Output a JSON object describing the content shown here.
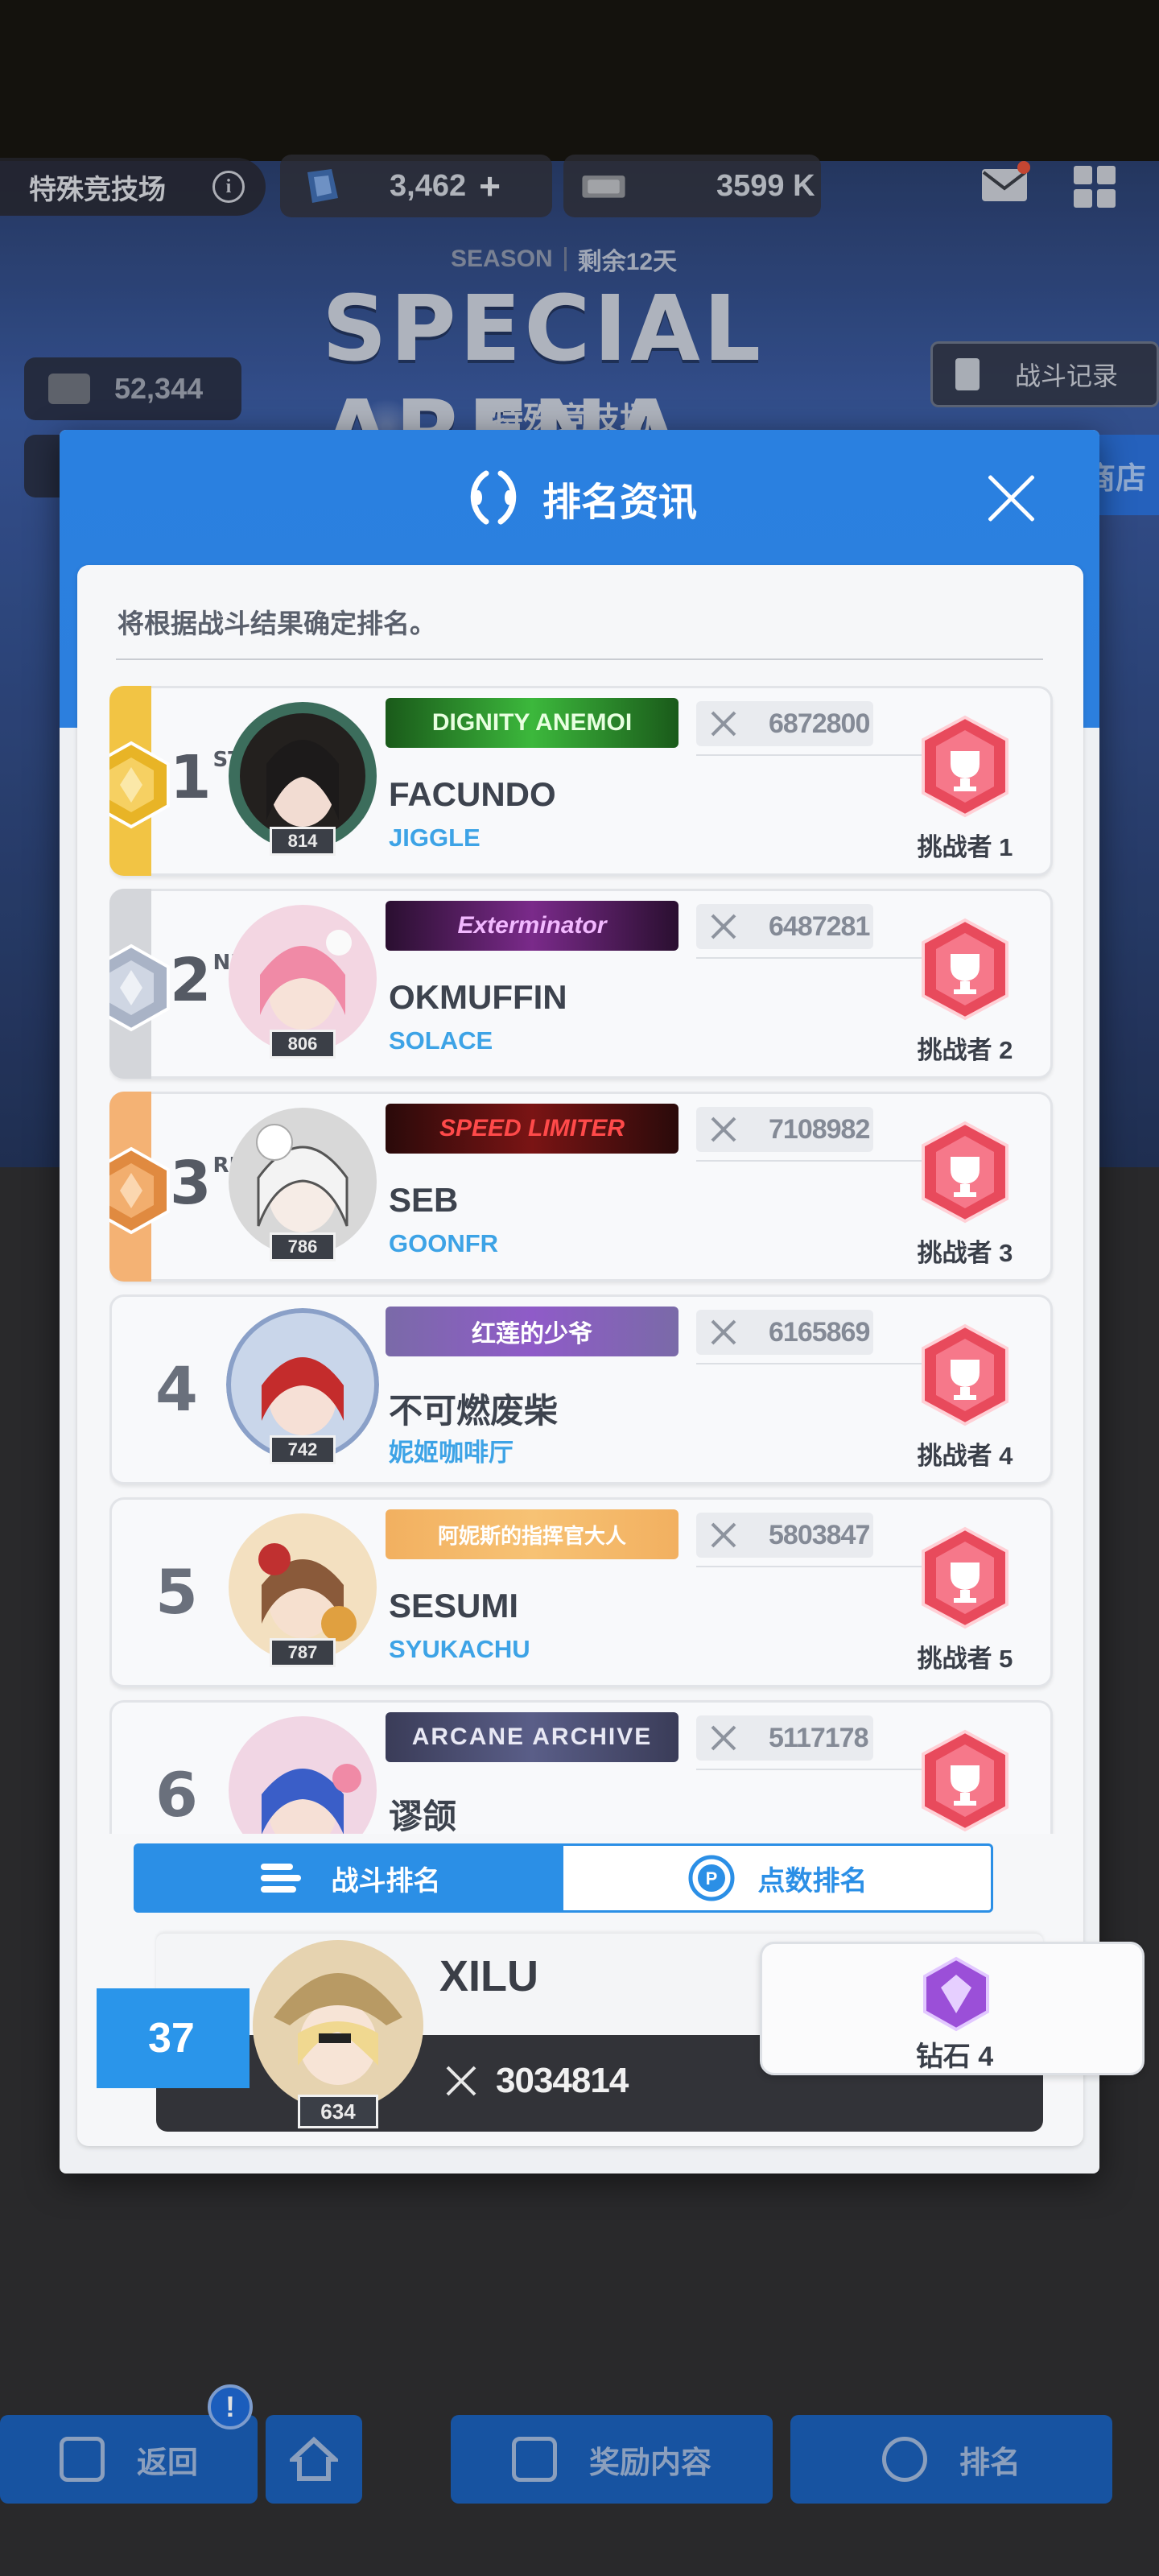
{
  "hud": {
    "mode_title": "特殊竞技场",
    "info_icon": "info-icon",
    "gems": "3,462",
    "gems_plus": "+",
    "credits": "3599 K",
    "ticket_count": "52,344"
  },
  "season": {
    "label": "SEASON",
    "remaining": "剩余12天",
    "title": "SPECIAL ARENA",
    "subtitle": "特殊竞技场"
  },
  "side_buttons": {
    "battle_record": "战斗记录",
    "shop": "商店"
  },
  "modal": {
    "title": "排名资讯",
    "notice": "将根据战斗结果确定排名。",
    "rows": [
      {
        "rank": "1",
        "suffix": "ST",
        "medal": "gold",
        "level": "814",
        "banner": "DIGNITY ANEMOI",
        "power": "6872800",
        "name": "FACUNDO",
        "guild": "JIGGLE",
        "challenge": "挑战者 1"
      },
      {
        "rank": "2",
        "suffix": "ND",
        "medal": "silver",
        "level": "806",
        "banner": "Exterminator",
        "power": "6487281",
        "name": "OKMUFFIN",
        "guild": "SOLACE",
        "challenge": "挑战者 2"
      },
      {
        "rank": "3",
        "suffix": "RD",
        "medal": "bronze",
        "level": "786",
        "banner": "SPEED LIMITER",
        "power": "7108982",
        "name": "SEB",
        "guild": "GOONFR",
        "challenge": "挑战者 3"
      },
      {
        "rank": "4",
        "suffix": "",
        "medal": "",
        "level": "742",
        "banner": "红莲的少爷",
        "power": "6165869",
        "name": "不可燃废柴",
        "guild": "妮姬咖啡厅",
        "challenge": "挑战者 4"
      },
      {
        "rank": "5",
        "suffix": "",
        "medal": "",
        "level": "787",
        "banner": "阿妮斯的指挥官大人",
        "power": "5803847",
        "name": "SESUMI",
        "guild": "SYUKACHU",
        "challenge": "挑战者 5"
      },
      {
        "rank": "6",
        "suffix": "",
        "medal": "",
        "level": "",
        "banner": "ARCANE ARCHIVE",
        "power": "5117178",
        "name": "谬颌",
        "guild": "",
        "challenge": ""
      }
    ],
    "tabs": {
      "battle": "战斗排名",
      "points": "点数排名"
    },
    "self": {
      "rank": "37",
      "level": "634",
      "name": "XILU",
      "power": "3034814",
      "tier": "钻石 4"
    }
  },
  "bottom_nav": {
    "back": "返回",
    "rewards": "奖励内容",
    "ranking": "排名",
    "alert": "!"
  },
  "colors": {
    "accent_blue": "#2b8fe6",
    "gold_stripe": "#f2c444",
    "silver_stripe": "#d4d6da",
    "bronze_stripe": "#f4b274",
    "guild_blue": "#3da3e6"
  }
}
